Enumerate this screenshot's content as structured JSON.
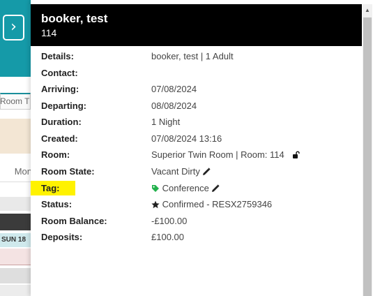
{
  "background": {
    "expand_glyph": "›",
    "tab_label": "Room T",
    "mon_label": "Mon",
    "sun_label": "SUN 18"
  },
  "panel": {
    "title": "booker, test",
    "subtitle": "114"
  },
  "details": [
    {
      "label": "Details:",
      "value": "booker, test | 1 Adult"
    },
    {
      "label": "Contact:",
      "value": ""
    },
    {
      "label": "Arriving:",
      "value": "07/08/2024"
    },
    {
      "label": "Departing:",
      "value": "08/08/2024"
    },
    {
      "label": "Duration:",
      "value": "1 Night"
    },
    {
      "label": "Created:",
      "value": "07/08/2024 13:16"
    },
    {
      "label": "Room:",
      "value": "Superior Twin Room | Room: 114",
      "icon": "unlock-icon"
    },
    {
      "label": "Room State:",
      "value": "Vacant Dirty",
      "icon": "pencil-icon"
    },
    {
      "label": "Tag:",
      "value": "Conference",
      "icon": "tag-icon",
      "highlighted": true
    },
    {
      "label": "Status:",
      "value": "Confirmed - RESX2759346",
      "icon": "star-icon"
    },
    {
      "label": "Room Balance:",
      "value": "-£100.00"
    },
    {
      "label": "Deposits:",
      "value": "£100.00"
    }
  ],
  "colors": {
    "header_bg": "#000000",
    "teal": "#159aa8",
    "tag_green": "#22b14c",
    "highlight": "#fff200"
  }
}
